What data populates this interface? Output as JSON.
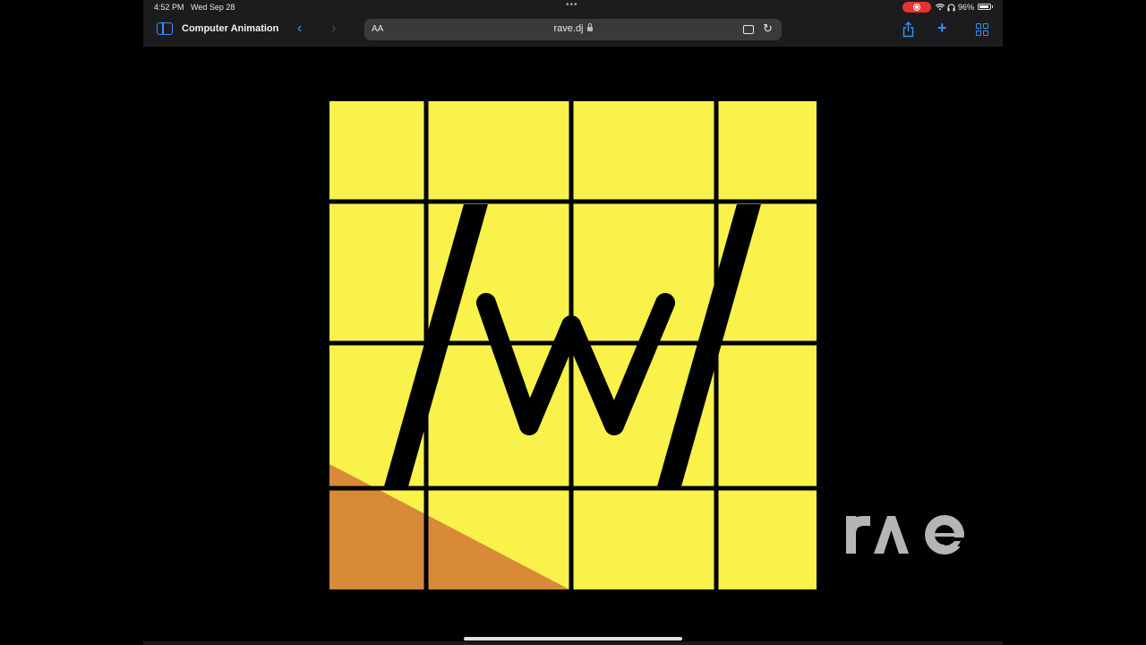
{
  "status_bar": {
    "time": "4:52 PM",
    "date": "Wed Sep 28",
    "battery": "96%"
  },
  "toolbar": {
    "tab_title": "Computer Animation",
    "aa_label": "AA",
    "url": "rave.dj"
  },
  "video": {
    "content": "W logo on yellow grid",
    "watermark": "rave"
  },
  "colors": {
    "yellow": "#f8f24a",
    "orange": "#d88a38",
    "accent": "#3a8ef6"
  }
}
